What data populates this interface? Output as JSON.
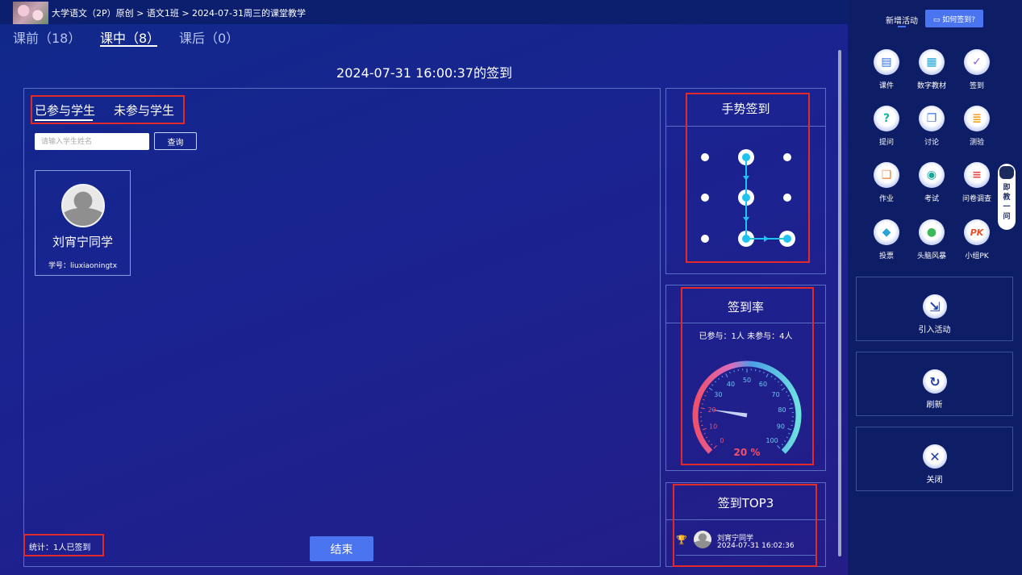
{
  "header": {
    "breadcrumb": "大学语文（2P）原创 > 语文1班 > 2024-07-31周三的课堂教学"
  },
  "phase_tabs": [
    {
      "label": "课前（18）"
    },
    {
      "label": "课中（8）",
      "active": true
    },
    {
      "label": "课后（0）"
    }
  ],
  "checkin": {
    "title": "2024-07-31 16:00:37的签到"
  },
  "students_panel": {
    "tabs": [
      {
        "label": "已参与学生",
        "active": true
      },
      {
        "label": "未参与学生"
      }
    ],
    "search_placeholder": "请输入学生姓名",
    "search_button": "查询",
    "students": [
      {
        "name": "刘宵宁同学",
        "id_label": "学号：liuxiaoningtx"
      }
    ],
    "stat_text": "统计：1人已签到",
    "end_button": "结束"
  },
  "gesture_card": {
    "title": "手势签到",
    "pattern": "top-middle > center > bottom-middle > bottom-right"
  },
  "rate_card": {
    "title": "签到率",
    "counts_text": "已参与：1人    未参与：4人",
    "gauge": {
      "min": 0,
      "max": 100,
      "value": 20,
      "ticks": [
        "0",
        "10",
        "20",
        "30",
        "40",
        "50",
        "60",
        "70",
        "80",
        "90",
        "100"
      ],
      "readout": "20 %"
    }
  },
  "top3_card": {
    "title": "签到TOP3",
    "entries": [
      {
        "name": "刘宵宁同学",
        "time": "2024-07-31 16:02:36"
      }
    ]
  },
  "right_panel": {
    "new_activity_label": "新增活动",
    "howto_label": "如何签到?",
    "tools": [
      {
        "label": "课件",
        "icon": "courseware-icon",
        "glyph": "▤",
        "color": "#2f6fe6"
      },
      {
        "label": "数字教材",
        "icon": "digital-textbook-icon",
        "glyph": "▦",
        "color": "#1ea7d8"
      },
      {
        "label": "签到",
        "icon": "checkin-icon",
        "glyph": "✓",
        "color": "#8a5ce6"
      },
      {
        "label": "提问",
        "icon": "question-icon",
        "glyph": "?",
        "color": "#17b59a"
      },
      {
        "label": "讨论",
        "icon": "discussion-icon",
        "glyph": "❐",
        "color": "#3c6fe0"
      },
      {
        "label": "测验",
        "icon": "quiz-icon",
        "glyph": "≣",
        "color": "#f2a31b"
      },
      {
        "label": "作业",
        "icon": "homework-icon",
        "glyph": "❑",
        "color": "#f07a2a"
      },
      {
        "label": "考试",
        "icon": "exam-icon",
        "glyph": "◉",
        "color": "#17a89a"
      },
      {
        "label": "问卷调查",
        "icon": "survey-icon",
        "glyph": "≡",
        "color": "#e64545"
      },
      {
        "label": "投票",
        "icon": "vote-icon",
        "glyph": "◆",
        "color": "#2aa3d8"
      },
      {
        "label": "头脑风暴",
        "icon": "brainstorm-icon",
        "glyph": "●",
        "color": "#3cb85a"
      },
      {
        "label": "小组PK",
        "icon": "group-pk-icon",
        "glyph": "PK",
        "color": "#e6502a"
      }
    ],
    "actions": [
      {
        "label": "引入活动",
        "icon": "import-activity-icon",
        "glyph": "⇲"
      },
      {
        "label": "刷新",
        "icon": "refresh-icon",
        "glyph": "↻"
      },
      {
        "label": "关闭",
        "icon": "close-icon",
        "glyph": "✕"
      }
    ],
    "ai_helper_text": "即教一问"
  }
}
